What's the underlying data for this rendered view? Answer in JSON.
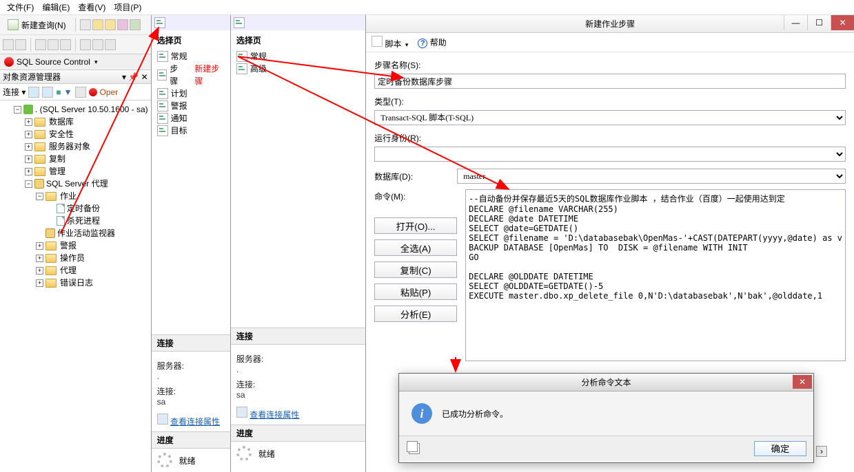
{
  "menu": {
    "file": "文件(F)",
    "edit": "编辑(E)",
    "view": "查看(V)",
    "project": "项目(P)"
  },
  "main_toolbar": {
    "new_query": "新建查询(N)"
  },
  "source_control": {
    "label": "SQL Source Control"
  },
  "explorer": {
    "title": "对象资源管理器",
    "connect": "连接 ▾",
    "open": "Oper",
    "root": ". (SQL Server 10.50.1600 - sa)",
    "nodes": {
      "db": "数据库",
      "security": "安全性",
      "server_objects": "服务器对象",
      "replication": "复制",
      "management": "管理",
      "agent": "SQL Server 代理",
      "jobs": "作业",
      "job1": "定时备份",
      "job2": "杀死进程",
      "activity": "作业活动监视器",
      "alerts": "警报",
      "operators": "操作员",
      "proxies": "代理",
      "errorlog": "错误日志"
    }
  },
  "mid1": {
    "header": "选择页",
    "items": [
      "常规",
      "步骤",
      "计划",
      "警报",
      "通知",
      "目标"
    ],
    "annotation": "新建步骤",
    "conn_header": "连接",
    "server_lab": "服务器:",
    "server_val": ".",
    "conn_lab": "连接:",
    "conn_val": "sa",
    "view_conn": "查看连接属性",
    "progress_header": "进度",
    "progress_val": "就绪"
  },
  "mid2": {
    "header": "选择页",
    "items": [
      "常规",
      "高级"
    ],
    "conn_header": "连接",
    "server_lab": "服务器:",
    "server_val": ".",
    "conn_lab": "连接:",
    "conn_val": "sa",
    "view_conn": "查看连接属性",
    "progress_header": "进度",
    "progress_val": "就绪"
  },
  "dialog": {
    "title": "新建作业步骤",
    "script_menu": "脚本",
    "help": "帮助",
    "step_name_lab": "步骤名称(S):",
    "step_name_val": "定时备份数据库步骤",
    "type_lab": "类型(T):",
    "type_val": "Transact-SQL 脚本(T-SQL)",
    "runas_lab": "运行身份(R):",
    "runas_val": "",
    "db_lab": "数据库(D):",
    "db_val": "master",
    "cmd_lab": "命令(M):",
    "buttons": {
      "open": "打开(O)...",
      "select_all": "全选(A)",
      "copy": "复制(C)",
      "paste": "粘贴(P)",
      "parse": "分析(E)"
    },
    "code": "--自动备份并保存最近5天的SQL数据库作业脚本 ，结合作业（百度）一起使用达到定\nDECLARE @filename VARCHAR(255)\nDECLARE @date DATETIME\nSELECT @date=GETDATE()\nSELECT @filename = 'D:\\databasebak\\OpenMas-'+CAST(DATEPART(yyyy,@date) as v\nBACKUP DATABASE [OpenMas] TO  DISK = @filename WITH INIT\nGO\n\nDECLARE @OLDDATE DATETIME\nSELECT @OLDDATE=GETDATE()-5\nEXECUTE master.dbo.xp_delete_file 0,N'D:\\databasebak',N'bak',@olddate,1"
  },
  "msgbox": {
    "title": "分析命令文本",
    "text": "已成功分析命令。",
    "ok": "确定"
  }
}
